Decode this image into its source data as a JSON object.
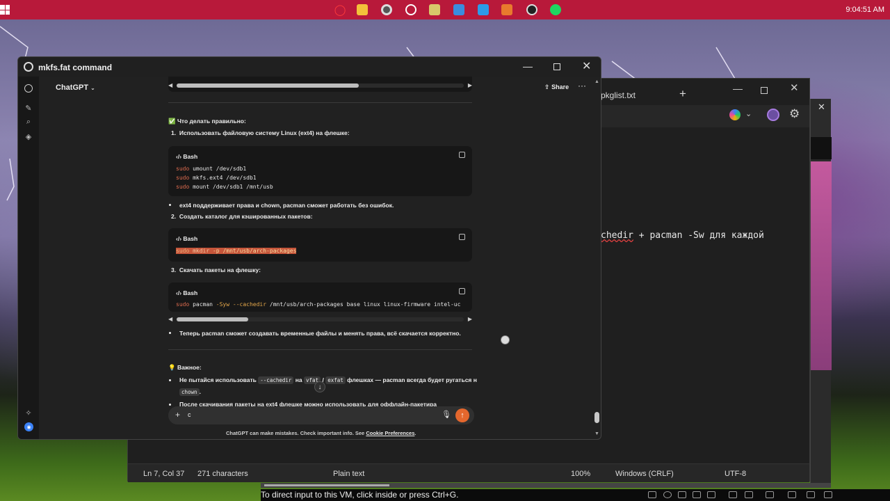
{
  "taskbar": {
    "clock": "9:04:51 AM",
    "icons": [
      "opera-icon",
      "file-explorer-icon",
      "obs-icon",
      "chatgpt-icon",
      "app-icon",
      "notepad-icon",
      "vscode-icon",
      "app-icon-2",
      "github-icon",
      "spotify-icon"
    ]
  },
  "notepad": {
    "tab_title": "pkglist.txt",
    "body_text_a": "chedir",
    "body_text_b": " + pacman -Sw для каждой",
    "status": {
      "position": "Ln 7, Col 37",
      "characters": "271 characters",
      "format": "Plain text",
      "zoom": "100%",
      "line_endings": "Windows (CRLF)",
      "encoding": "UTF-8"
    }
  },
  "vm": {
    "hint": "To direct input to this VM, click inside or press Ctrl+G."
  },
  "chatgpt": {
    "window_title": "mkfs.fat command",
    "model_label": "ChatGPT",
    "share_label": "Share",
    "section_right_heading": "✅ Что делать правильно:",
    "step1_num": "1.",
    "step1": "Использовать файловую систему Linux (ext4) на флешке:",
    "code_lang": "Bash",
    "code1_lines": [
      {
        "cmd": "sudo",
        "rest": " umount /dev/sdb1"
      },
      {
        "cmd": "sudo",
        "rest": " mkfs.ext4 /dev/sdb1"
      },
      {
        "cmd": "sudo",
        "rest": " mount /dev/sdb1 /mnt/usb"
      }
    ],
    "bullet1": "ext4 поддерживает права и chown, pacman сможет работать без ошибок.",
    "step2_num": "2.",
    "step2": "Создать каталог для кэшированных пакетов:",
    "code2": {
      "cmd": "sudo",
      "mid": " mkdir ",
      "flag": "-p",
      "rest": " /mnt/usb/arch-packages"
    },
    "step3_num": "3.",
    "step3": "Скачать пакеты на флешку:",
    "code3": {
      "cmd": "sudo",
      "a": " pacman ",
      "flag1": "-Syw",
      "b": " ",
      "flag2": "--cachedir",
      "rest": " /mnt/usb/arch-packages base linux linux-firmware intel-uc"
    },
    "bullet2": "Теперь pacman сможет создавать временные файлы и менять права, всё скачается корректно.",
    "important_heading": "💡 Важное:",
    "imp1_a": "Не пытайся использовать ",
    "imp1_code1": "--cachedir",
    "imp1_b": " на ",
    "imp1_code2": "vfat",
    "imp1_c": " / ",
    "imp1_code3": "exfat",
    "imp1_d": " флешках — pacman всегда будет ругаться на",
    "imp1_code4": "chown",
    "imp1_e": ".",
    "imp2": "После скачивания пакеты на ext4 флешке можно использовать для оффлайн-пакетира",
    "composer_value": "c",
    "disclaimer_a": "ChatGPT can make mistakes. Check important info. See ",
    "disclaimer_link": "Cookie Preferences",
    "disclaimer_b": "."
  }
}
